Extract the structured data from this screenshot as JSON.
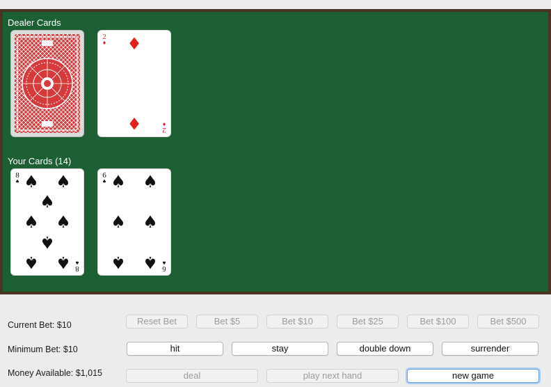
{
  "dealer": {
    "label": "Dealer Cards"
  },
  "player": {
    "label": "Your Cards (14)"
  },
  "cards": {
    "dealer_up": {
      "rank": "2",
      "suit": "♦"
    },
    "player_1": {
      "rank": "8",
      "suit": "♠"
    },
    "player_2": {
      "rank": "6",
      "suit": "♠"
    }
  },
  "info": {
    "current_bet": "Current Bet: $10",
    "minimum_bet": "Minimum Bet: $10",
    "money": "Money Available: $1,015"
  },
  "bet_buttons": {
    "reset": "Reset Bet",
    "bet5": "Bet $5",
    "bet10": "Bet $10",
    "bet25": "Bet $25",
    "bet100": "Bet $100",
    "bet500": "Bet $500"
  },
  "action_buttons": {
    "hit": "hit",
    "stay": "stay",
    "double": "double down",
    "surrender": "surrender"
  },
  "game_buttons": {
    "deal": "deal",
    "next": "play next hand",
    "new_game": "new game"
  },
  "colors": {
    "felt": "#1c5f33",
    "table_border": "#4a3524",
    "card_back": "#d63a3a",
    "red_suit": "#e2211c"
  }
}
